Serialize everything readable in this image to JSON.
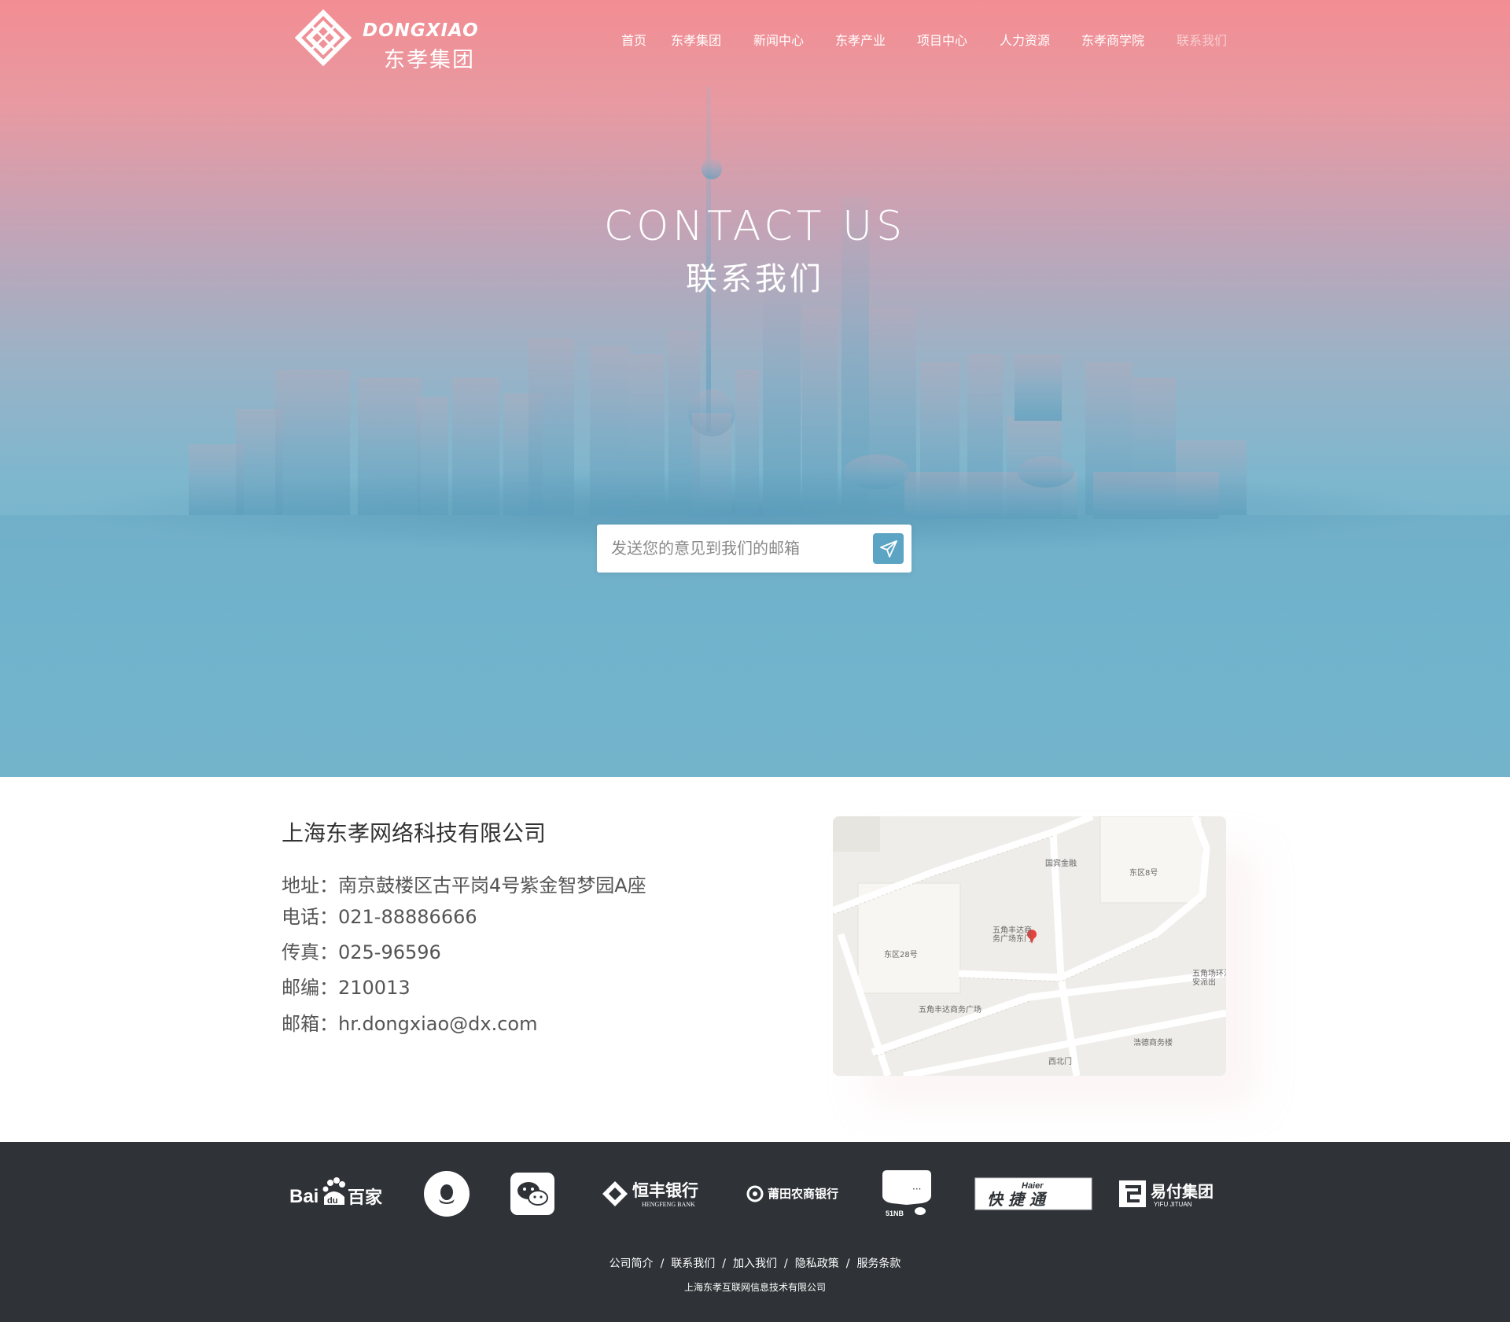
{
  "brand": {
    "logo_en": "DONGXIAO",
    "logo_cn": "东孝集团"
  },
  "nav": {
    "items": [
      "首页",
      "东孝集团",
      "新闻中心",
      "东孝产业",
      "项目中心",
      "人力资源",
      "东孝商学院",
      "联系我们"
    ],
    "active": "联系我们"
  },
  "hero": {
    "title": "CONTACT US",
    "subtitle": "联系我们",
    "email_placeholder": "发送您的意见到我们的邮箱",
    "send_icon": "paper-plane-icon"
  },
  "contact": {
    "company": "上海东孝网络科技有限公司",
    "rows": [
      {
        "label": "地址：",
        "value": "南京鼓楼区古平岗4号紫金智梦园A座"
      },
      {
        "label": "电话：",
        "value": "021-88886666"
      },
      {
        "label": "传真：",
        "value": "025-96596"
      },
      {
        "label": "邮编：",
        "value": "210013"
      },
      {
        "label": "邮箱：",
        "value": "hr.dongxiao@dx.com"
      }
    ]
  },
  "map": {
    "labels": [
      "东区8号",
      "五角丰达商务广场东门",
      "东区28号",
      "五角丰达商务广场",
      "五角场环治安派出",
      "浩德商务楼",
      "西北门",
      "国宾金融"
    ]
  },
  "footer": {
    "partners": [
      {
        "name": "baidu",
        "text": "Bai百家"
      },
      {
        "name": "qq",
        "text": ""
      },
      {
        "name": "wechat",
        "text": ""
      },
      {
        "name": "hengfeng",
        "text": "恒丰银行",
        "sub": "HENGFENG BANK"
      },
      {
        "name": "putian",
        "text": "莆田农商银行"
      },
      {
        "name": "51nb",
        "text": "51NB"
      },
      {
        "name": "haier",
        "text": "快捷通",
        "sub": "Haier"
      },
      {
        "name": "yifu",
        "text": "易付集团",
        "sub": "YIFU JITUAN"
      }
    ],
    "links": [
      "公司简介",
      "联系我们",
      "加入我们",
      "隐私政策",
      "服务条款"
    ],
    "copyright": "上海东孝互联网信息技术有限公司"
  },
  "colors": {
    "hero_top": "#f38d93",
    "hero_bottom": "#73b4cb",
    "send_button": "#5ba4c4",
    "footer_bg": "#2f3337"
  }
}
